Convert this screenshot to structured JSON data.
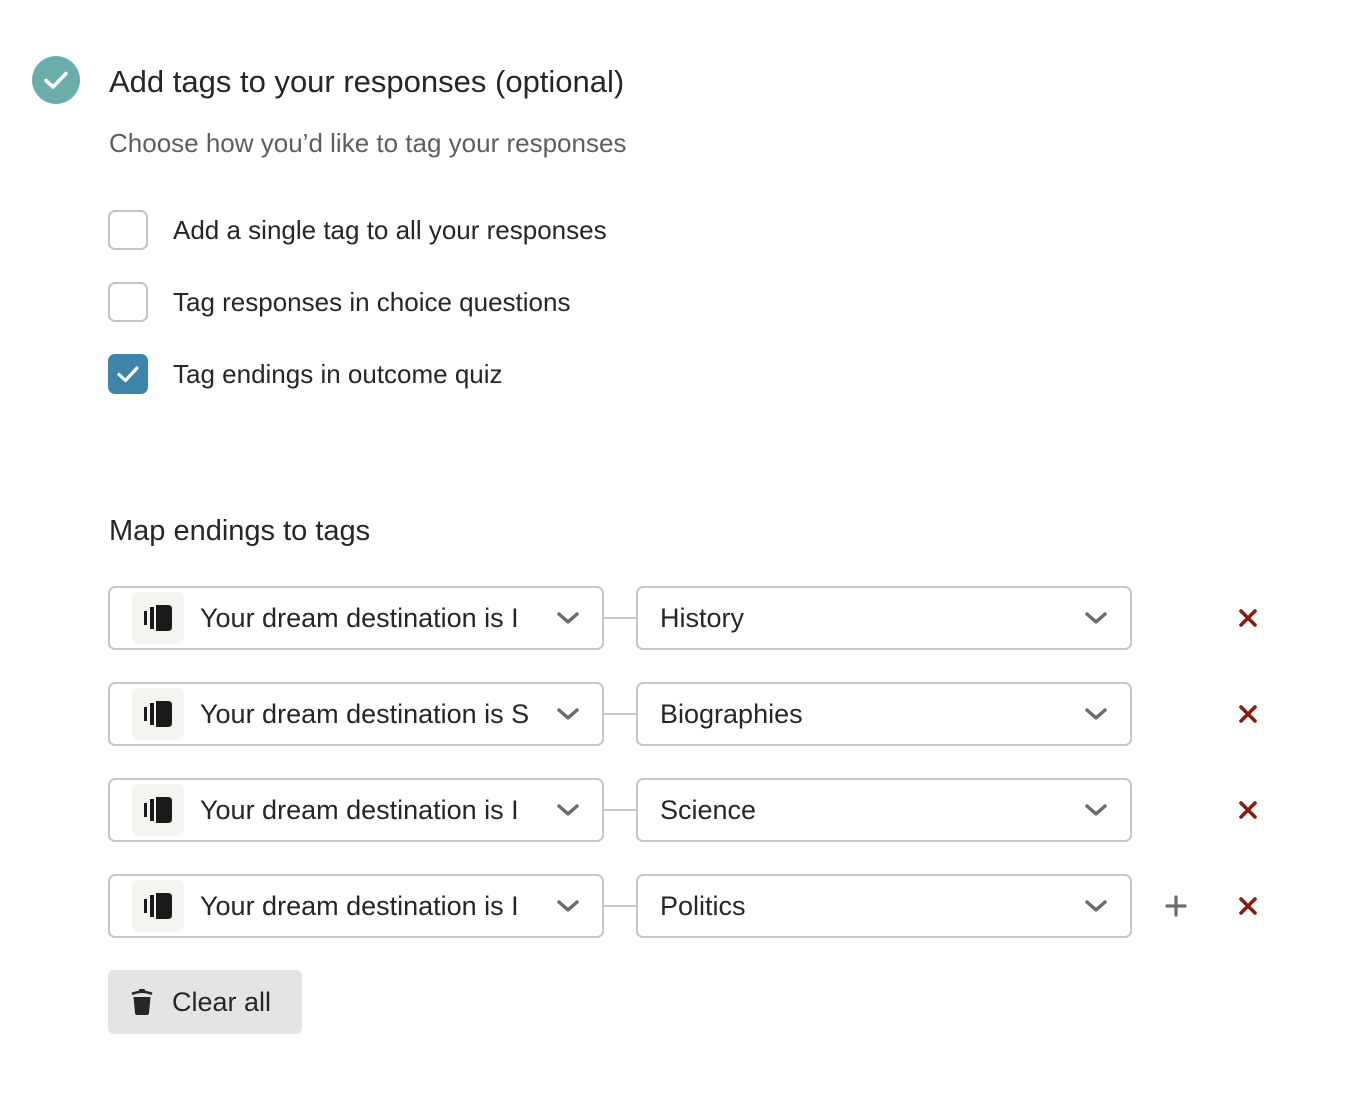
{
  "header": {
    "step_icon": "check-circle-icon",
    "step_status_color": "#6aaeab",
    "title": "Add tags to your responses (optional)",
    "subtitle": "Choose how you’d like to tag your responses"
  },
  "options": [
    {
      "label": "Add a single tag to all your responses",
      "checked": false
    },
    {
      "label": "Tag responses in choice questions",
      "checked": false
    },
    {
      "label": "Tag endings in outcome quiz",
      "checked": true
    }
  ],
  "accent_color": "#3d84a8",
  "mapping": {
    "title": "Map endings to tags",
    "ending_icon": "ending-screen-icon",
    "rows": [
      {
        "ending": "Your dream destination is I",
        "tag": "History",
        "show_add": false
      },
      {
        "ending": "Your dream destination is S",
        "tag": "Biographies",
        "show_add": false
      },
      {
        "ending": "Your dream destination is I",
        "tag": "Science",
        "show_add": false
      },
      {
        "ending": "Your dream destination is I",
        "tag": "Politics",
        "show_add": true
      }
    ],
    "add_icon": "plus-icon",
    "remove_icon": "close-icon",
    "remove_color": "#8b1a14"
  },
  "clear_all": {
    "label": "Clear all",
    "icon": "trash-icon"
  }
}
